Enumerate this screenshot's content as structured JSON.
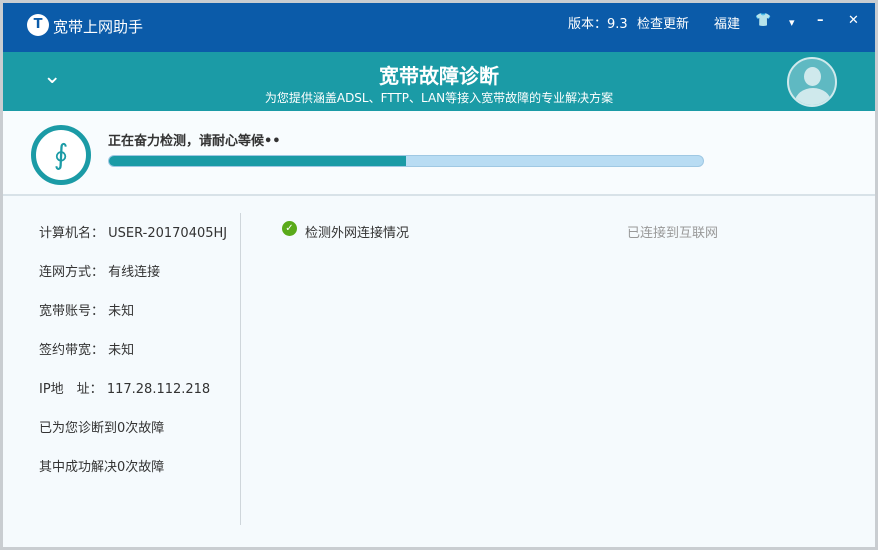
{
  "titlebar": {
    "app_name": "宽带上网助手",
    "version": "版本：9.3",
    "check_update": "检查更新",
    "region": "福建",
    "logo": "T"
  },
  "banner": {
    "title": "宽带故障诊断",
    "subtitle": "为您提供涵盖ADSL、FTTP、LAN等接入宽带故障的专业解决方案"
  },
  "status": {
    "text": "正在奋力检测，请耐心等候••",
    "progress_percent": 50
  },
  "info": [
    {
      "label": "计算机名：",
      "value": "USER-20170405HJ"
    },
    {
      "label": "连网方式：",
      "value": "有线连接"
    },
    {
      "label": "宽带账号：",
      "value": "未知"
    },
    {
      "label": "签约带宽：",
      "value": "未知"
    },
    {
      "label": "IP地　址：",
      "value": "117.28.112.218"
    }
  ],
  "stats": {
    "diagnosed": "已为您诊断到0次故障",
    "solved": "其中成功解决0次故障"
  },
  "checks": [
    {
      "name": "检测外网连接情况",
      "result": "已连接到互联网"
    }
  ],
  "colors": {
    "titlebar": "#0b5ba9",
    "banner": "#1b9ba6",
    "success": "#5aaa1a"
  }
}
